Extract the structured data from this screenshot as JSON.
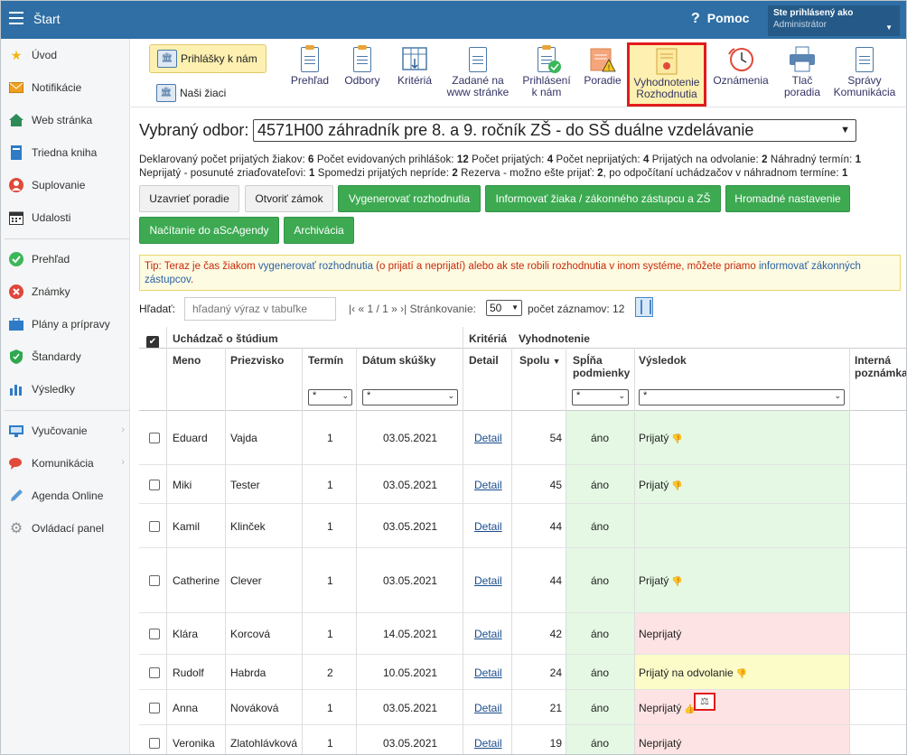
{
  "topbar": {
    "title": "Štart",
    "help_label": "Pomoc",
    "user_line1": "Ste prihlásený ako",
    "user_line2": "Administrátor"
  },
  "sidebar": {
    "items": [
      {
        "label": "Úvod",
        "icon": "star-icon"
      },
      {
        "label": "Notifikácie",
        "icon": "envelope-icon"
      },
      {
        "label": "Web stránka",
        "icon": "house-icon"
      },
      {
        "label": "Triedna kniha",
        "icon": "book-icon"
      },
      {
        "label": "Suplovanie",
        "icon": "person-icon"
      },
      {
        "label": "Udalosti",
        "icon": "calendar-icon"
      },
      {
        "label": "Prehľad",
        "icon": "check-icon"
      },
      {
        "label": "Známky",
        "icon": "grade-icon"
      },
      {
        "label": "Plány a prípravy",
        "icon": "briefcase-icon"
      },
      {
        "label": "Štandardy",
        "icon": "shield-icon"
      },
      {
        "label": "Výsledky",
        "icon": "bar-chart-icon"
      },
      {
        "label": "Vyučovanie",
        "icon": "teacher-icon"
      },
      {
        "label": "Komunikácia",
        "icon": "chat-icon"
      },
      {
        "label": "Agenda Online",
        "icon": "pen-icon"
      },
      {
        "label": "Ovládací panel",
        "icon": "gear-icon"
      }
    ]
  },
  "toolbar": {
    "prihlasky": "Prihlášky k nám",
    "ziaci": "Naši žiaci",
    "buttons": [
      "Prehľad",
      "Odbory",
      "Kritériá",
      "Zadané na",
      "www stránke",
      "Prihlásení",
      "k nám",
      "Poradie",
      "Vyhodnotenie",
      "Rozhodnutia",
      "Oznámenia",
      "Tlač",
      "poradia",
      "Správy",
      "Komunikácia"
    ]
  },
  "odbor": {
    "label": "Vybraný odbor:",
    "value": "4571H00 záhradník pre 8. a 9. ročník ZŠ - do SŠ duálne vzdelávanie"
  },
  "stats": {
    "l1a": "Deklarovaný počet prijatých žiakov: ",
    "l1b": "6",
    "l1c": " Počet evidovaných prihlášok: ",
    "l1d": "12",
    "l1e": " Počet prijatých: ",
    "l1f": "4",
    "l1g": " Počet neprijatých: ",
    "l1h": "4",
    "l1i": " Prijatých na odvolanie: ",
    "l1j": "2",
    "l1k": " Náhradný termín: ",
    "l1l": "1",
    "l2a": "Neprijatý - posunuté zriaďovateľovi: ",
    "l2b": "1",
    "l2c": " Spomedzi prijatých nepríde: ",
    "l2d": "2",
    "l2e": " Rezerva - možno ešte prijať: ",
    "l2f": "2",
    "l2g": ", po odpočítaní uchádzačov v náhradnom termíne: ",
    "l2h": "1"
  },
  "actions": {
    "uzavriet": "Uzavrieť poradie",
    "otvorit": "Otvoriť zámok",
    "vygenerovat": "Vygenerovať rozhodnutia",
    "informovat": "Informovať žiaka / zákonného zástupcu a ZŠ",
    "hromadne": "Hromadné nastavenie",
    "nacitanie": "Načítanie do aScAgendy",
    "archivacia": "Archivácia"
  },
  "tip": {
    "t1": "Tip: Teraz je čas žiakom ",
    "l1": "vygenerovať rozhodnutia",
    "t2": " (o prijatí a neprijatí) alebo ak ste robili rozhodnutia v inom systéme, môžete priamo ",
    "l2": "informovať zákonných",
    "l3": "zástupcov",
    "t3": "."
  },
  "search": {
    "label": "Hľadať:",
    "placeholder": "hľadaný výraz v tabuľke",
    "pager": "|‹ « 1 / 1 » ›|  Stránkovanie:",
    "page_size": "50",
    "count_label": "počet záznamov: 12"
  },
  "table": {
    "group_headers": [
      "Uchádzač o štúdium",
      "Kritériá",
      "Vyhodnotenie"
    ],
    "headers": [
      "Meno",
      "Priezvisko",
      "Termín",
      "Dátum skúšky",
      "Detail",
      "Spolu",
      "Spĺňa",
      "podmienky",
      "Výsledok",
      "Interná",
      "poznámka"
    ],
    "filter_value": "*",
    "rows": [
      {
        "meno": "Eduard",
        "priezvisko": "Vajda",
        "termin": "1",
        "datum": "03.05.2021",
        "detail": "Detail",
        "spolu": "54",
        "splna": "áno",
        "vysledok": "Prijatý",
        "band": "green"
      },
      {
        "meno": "Miki",
        "priezvisko": "Tester",
        "termin": "1",
        "datum": "03.05.2021",
        "detail": "Detail",
        "spolu": "45",
        "splna": "áno",
        "vysledok": "Prijatý",
        "band": "green"
      },
      {
        "meno": "Kamil",
        "priezvisko": "Klinček",
        "termin": "1",
        "datum": "03.05.2021",
        "detail": "Detail",
        "spolu": "44",
        "splna": "áno",
        "vysledok": "",
        "band": "green"
      },
      {
        "meno": "Catherine",
        "priezvisko": "Clever",
        "termin": "1",
        "datum": "03.05.2021",
        "detail": "Detail",
        "spolu": "44",
        "splna": "áno",
        "vysledok": "Prijatý",
        "band": "green"
      },
      {
        "meno": "Klára",
        "priezvisko": "Korcová",
        "termin": "1",
        "datum": "14.05.2021",
        "detail": "Detail",
        "spolu": "42",
        "splna": "áno",
        "vysledok": "Neprijatý",
        "band": "red"
      },
      {
        "meno": "Rudolf",
        "priezvisko": "Habrda",
        "termin": "2",
        "datum": "10.05.2021",
        "detail": "Detail",
        "spolu": "24",
        "splna": "áno",
        "vysledok": "Prijatý na odvolanie",
        "band": "yellow"
      },
      {
        "meno": "Anna",
        "priezvisko": "Nováková",
        "termin": "1",
        "datum": "03.05.2021",
        "detail": "Detail",
        "spolu": "21",
        "splna": "áno",
        "vysledok": "Neprijatý",
        "band": "red"
      },
      {
        "meno": "Veronika",
        "priezvisko": "Zlatohlávková",
        "termin": "1",
        "datum": "03.05.2021",
        "detail": "Detail",
        "spolu": "19",
        "splna": "áno",
        "vysledok": "Neprijatý",
        "band": "red"
      }
    ]
  }
}
